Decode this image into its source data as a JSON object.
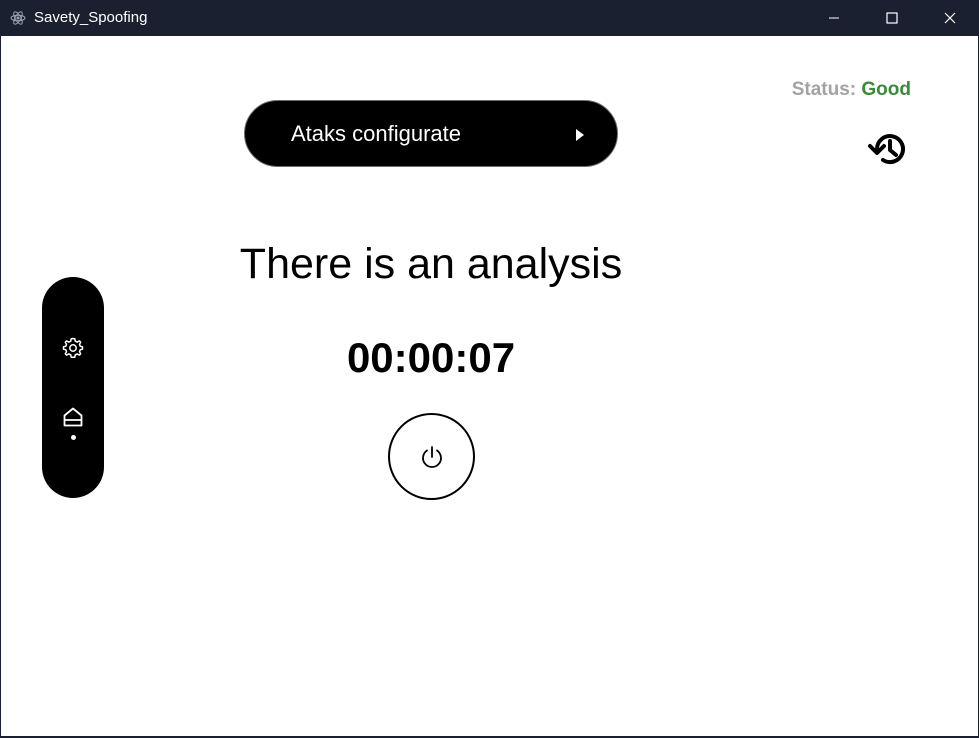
{
  "window": {
    "title": "Savety_Spoofing"
  },
  "status": {
    "label": "Status:",
    "value": "Good",
    "value_color": "#3c8a3a",
    "label_color": "#a3a3a3"
  },
  "ataks_button": {
    "label": "Ataks configurate"
  },
  "analysis": {
    "message": "There is an analysis",
    "timer": "00:00:07"
  },
  "icons": {
    "app": "electron-icon",
    "history": "history-icon",
    "power": "power-icon",
    "settings": "gear-icon",
    "home": "home-icon",
    "dropdown": "caret-right-icon"
  },
  "nav": {
    "active_item": "home"
  }
}
